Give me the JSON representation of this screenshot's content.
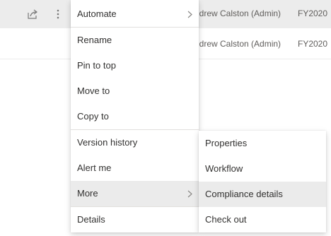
{
  "list": {
    "rows": [
      {
        "modified_by": "ndrew Calston (Admin)",
        "fiscal_year": "FY2020"
      },
      {
        "modified_by": "ndrew Calston (Admin)",
        "fiscal_year": "FY2020"
      }
    ]
  },
  "icons": {
    "share": "share-icon",
    "more": "more-vertical-icon",
    "chevron": "chevron-right-icon"
  },
  "context_menu": {
    "items": [
      {
        "label": "Automate",
        "has_submenu": true
      },
      {
        "label": "Rename"
      },
      {
        "label": "Pin to top"
      },
      {
        "label": "Move to"
      },
      {
        "label": "Copy to"
      },
      {
        "label": "Version history"
      },
      {
        "label": "Alert me"
      },
      {
        "label": "More",
        "has_submenu": true,
        "selected": true
      },
      {
        "label": "Details"
      }
    ]
  },
  "submenu": {
    "items": [
      {
        "label": "Properties"
      },
      {
        "label": "Workflow"
      },
      {
        "label": "Compliance details",
        "selected": true
      },
      {
        "label": "Check out"
      }
    ]
  },
  "colors": {
    "selected_row_bg": "#ececec",
    "menu_hover_bg": "#ebebeb",
    "text": "#323130",
    "secondary_text": "#605e5c"
  }
}
